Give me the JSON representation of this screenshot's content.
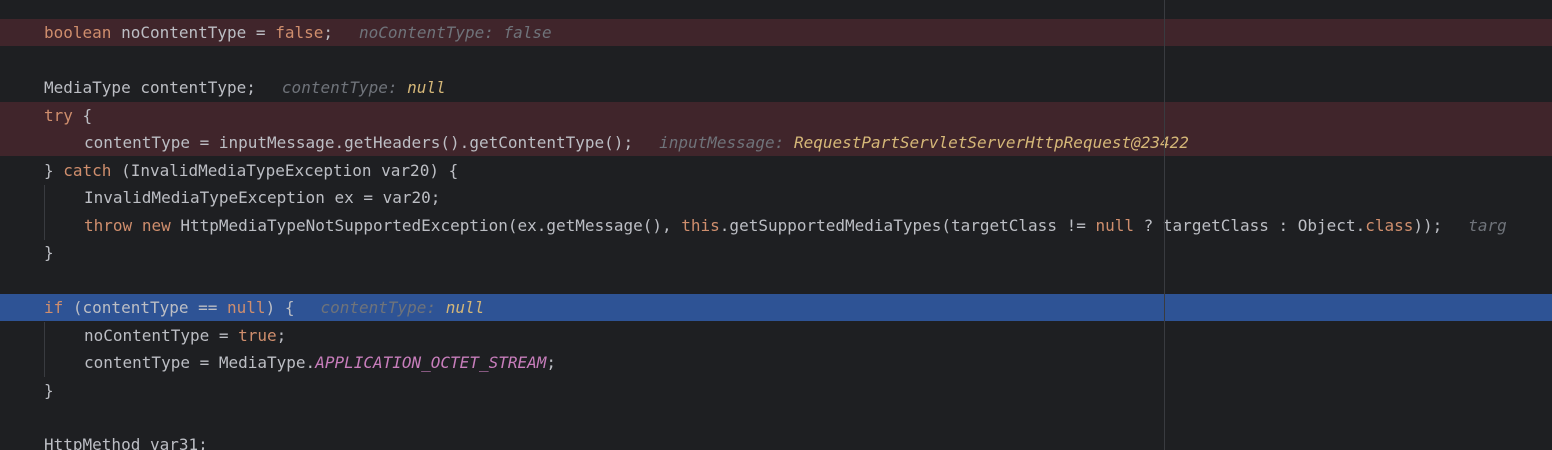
{
  "lines": {
    "l1": {
      "t1": "boolean",
      "t2": " noContentType = ",
      "t3": "false",
      "t4": ";",
      "hint_name": "noContentType:",
      "hint_val": "false"
    },
    "l3": {
      "t1": "MediaType contentType;",
      "hint_name": "contentType:",
      "hint_val": "null"
    },
    "l4": {
      "t1": "try",
      "t2": " {"
    },
    "l5": {
      "t1": "contentType = inputMessage.getHeaders().getContentType();",
      "hint_name": "inputMessage:",
      "hint_val": "RequestPartServletServerHttpRequest@23422"
    },
    "l6": {
      "t1": "} ",
      "t2": "catch",
      "t3": " (InvalidMediaTypeException var20) {"
    },
    "l7": {
      "t1": "InvalidMediaTypeException ex = var20;"
    },
    "l8": {
      "t1": "throw",
      "t2": " ",
      "t3": "new",
      "t4": " HttpMediaTypeNotSupportedException(ex.getMessage(), ",
      "t5": "this",
      "t6": ".getSupportedMediaTypes(targetClass != ",
      "t7": "null",
      "t8": " ? targetClass : Object.",
      "t9": "class",
      "t10": "));",
      "hint_name": "targ"
    },
    "l9": {
      "t1": "}"
    },
    "l11": {
      "t1": "if",
      "t2": " (contentType == ",
      "t3": "null",
      "t4": ") {",
      "hint_name": "contentType:",
      "hint_val": "null"
    },
    "l12": {
      "t1": "noContentType = ",
      "t2": "true",
      "t3": ";"
    },
    "l13": {
      "t1": "contentType = MediaType.",
      "t2": "APPLICATION_OCTET_STREAM",
      "t3": ";"
    },
    "l14": {
      "t1": "}"
    },
    "l16": {
      "t1": "HttpMethod var31;"
    }
  },
  "colors": {
    "background": "#1e1f22",
    "breakpoint_line": "#40252b",
    "execution_line": "#2e5395",
    "keyword": "#cf8e6d",
    "constant": "#c77dbb",
    "inline_value": "#d5b778"
  }
}
